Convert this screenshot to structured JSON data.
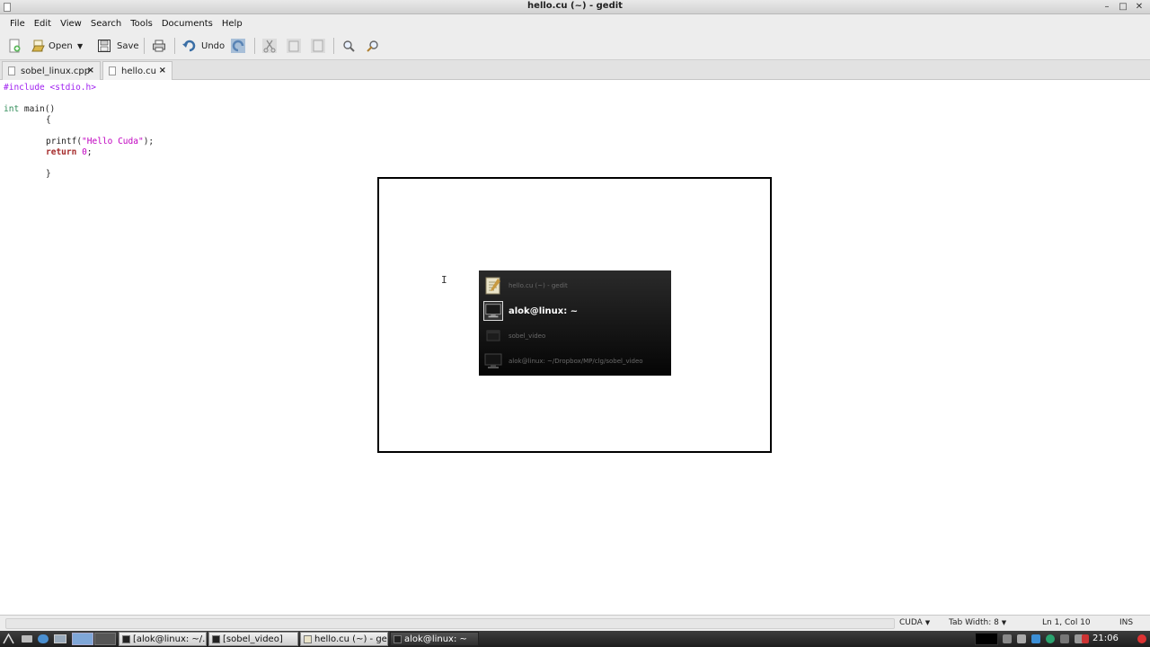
{
  "window": {
    "title": "hello.cu (~) - gedit"
  },
  "menu": [
    "File",
    "Edit",
    "View",
    "Search",
    "Tools",
    "Documents",
    "Help"
  ],
  "toolbar": {
    "open_label": "Open",
    "save_label": "Save",
    "undo_label": "Undo"
  },
  "tabs": [
    {
      "label": "sobel_linux.cpp",
      "close": "×"
    },
    {
      "label": "hello.cu",
      "close": "×"
    }
  ],
  "code": {
    "l1": "#include <stdio.h>",
    "l3a": "int",
    "l3b": " main()",
    "l4": "{",
    "l6a": "printf(",
    "l6b": "\"Hello Cuda\"",
    "l6c": ");",
    "l7a": "return",
    "l7b": " ",
    "l7c": "0",
    "l7d": ";",
    "l9": "}"
  },
  "switcher": {
    "items": [
      {
        "label": "hello.cu (~) - gedit",
        "icon": "text-editor-icon"
      },
      {
        "label": "alok@linux: ~",
        "icon": "terminal-icon",
        "selected": true
      },
      {
        "label": "sobel_video",
        "icon": "video-window-icon"
      },
      {
        "label": "alok@linux: ~/Dropbox/MP/clg/sobel_video",
        "icon": "terminal-icon"
      }
    ]
  },
  "statusbar": {
    "language": "CUDA",
    "tab_width": "Tab Width: 8",
    "position": "Ln 1, Col 10",
    "mode": "INS"
  },
  "taskbar": {
    "tasks": [
      {
        "label": "[alok@linux: ~/..."
      },
      {
        "label": "[sobel_video]"
      },
      {
        "label": "hello.cu (~) - gedit"
      },
      {
        "label": "alok@linux: ~"
      }
    ],
    "clock": "21:06"
  }
}
